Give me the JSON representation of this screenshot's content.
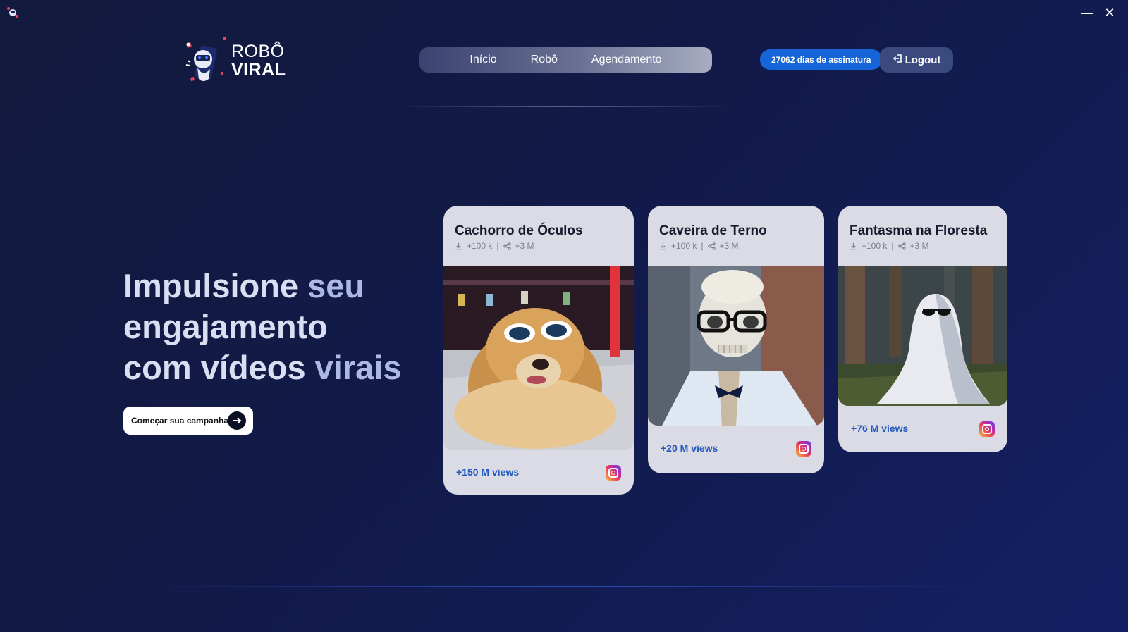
{
  "window": {
    "minimize_label": "—",
    "close_label": "✕"
  },
  "logo": {
    "line1": "ROBÔ",
    "line2": "VIRAL"
  },
  "nav": {
    "items": [
      "Início",
      "Robô",
      "Agendamento"
    ]
  },
  "header": {
    "subscription_badge": "27062 dias de assinatura",
    "logout_label": "Logout"
  },
  "hero": {
    "title_part1": "Impulsione ",
    "title_accent1": "seu",
    "title_part2": "engajamento",
    "title_part3": "com vídeos ",
    "title_accent2": "virais",
    "cta_label": "Começar sua campanha"
  },
  "cards": [
    {
      "title": "Cachorro de Óculos",
      "downloads": "+100 k",
      "separator": "|",
      "shares": "+3 M",
      "views": "+150 M views",
      "icon": "instagram-icon"
    },
    {
      "title": "Caveira de Terno",
      "downloads": "+100 k",
      "separator": "|",
      "shares": "+3 M",
      "views": "+20 M views",
      "icon": "instagram-icon"
    },
    {
      "title": "Fantasma na Floresta",
      "downloads": "+100 k",
      "separator": "|",
      "shares": "+3 M",
      "views": "+76 M views",
      "icon": "instagram-icon"
    }
  ],
  "colors": {
    "accent_blue": "#1565d8",
    "views_text": "#2258c0",
    "card_bg": "#dadbe4"
  }
}
